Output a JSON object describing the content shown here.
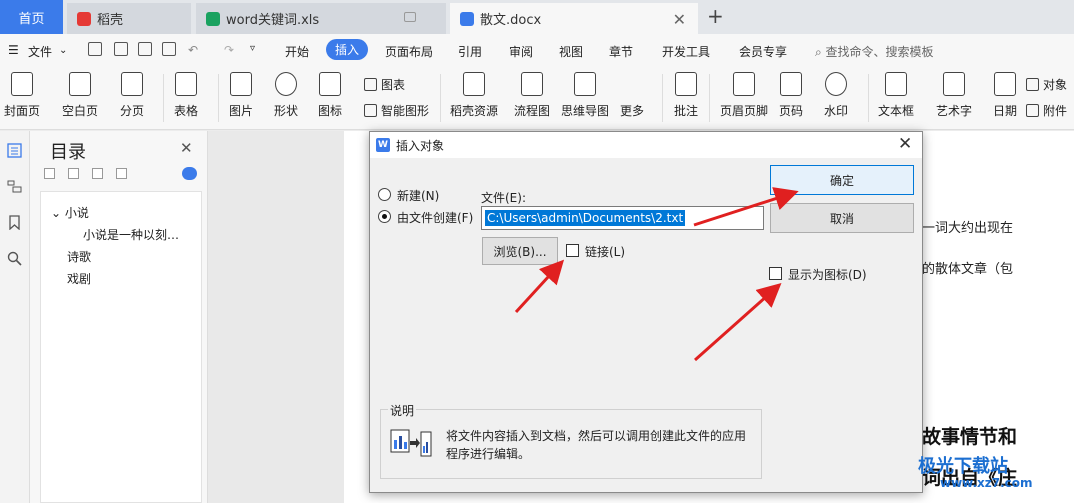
{
  "tabs": {
    "home": "首页",
    "tab1": "稻壳",
    "tab2": "word关键词.xls",
    "tab3": "散文.docx"
  },
  "menu": {
    "file": "文件",
    "items": [
      "开始",
      "插入",
      "页面布局",
      "引用",
      "审阅",
      "视图",
      "章节",
      "开发工具",
      "会员专享"
    ],
    "active": "插入",
    "search": "查找命令、搜索模板"
  },
  "ribbon": {
    "cover": "封面页",
    "blank": "空白页",
    "pagebreak": "分页",
    "table": "表格",
    "picture": "图片",
    "shape": "形状",
    "icon": "图标",
    "chart": "图表",
    "smartart": "智能图形",
    "docer": "稻壳资源",
    "flowchart": "流程图",
    "mindmap": "思维导图",
    "more": "更多",
    "comment": "批注",
    "headerfooter": "页眉页脚",
    "pagenum": "页码",
    "watermark": "水印",
    "textbox": "文本框",
    "wordart": "艺术字",
    "date": "日期",
    "object": "对象",
    "attachment": "附件"
  },
  "toc": {
    "title": "目录",
    "items": [
      "小说",
      "小说是一种以刻…",
      "诗歌",
      "戏剧"
    ]
  },
  "doc": {
    "line1": "一词大约出现在",
    "line2": "的散体文章（包",
    "bold1": "故事情节和",
    "bold2": "词出自《庄"
  },
  "dialog": {
    "title": "插入对象",
    "new_label": "新建(N)",
    "fromfile_label": "由文件创建(F)",
    "file_label": "文件(E):",
    "file_value": "C:\\Users\\admin\\Documents\\2.txt",
    "browse": "浏览(B)...",
    "link": "链接(L)",
    "ok": "确定",
    "cancel": "取消",
    "display_icon": "显示为图标(D)",
    "desc_title": "说明",
    "desc_text": "将文件内容插入到文档，然后可以调用创建此文件的应用程序进行编辑。"
  },
  "watermark": {
    "text": "极光下载站",
    "url": "www.xz7.com"
  },
  "colors": {
    "accent": "#3b7bea",
    "arrow": "#e02020"
  }
}
